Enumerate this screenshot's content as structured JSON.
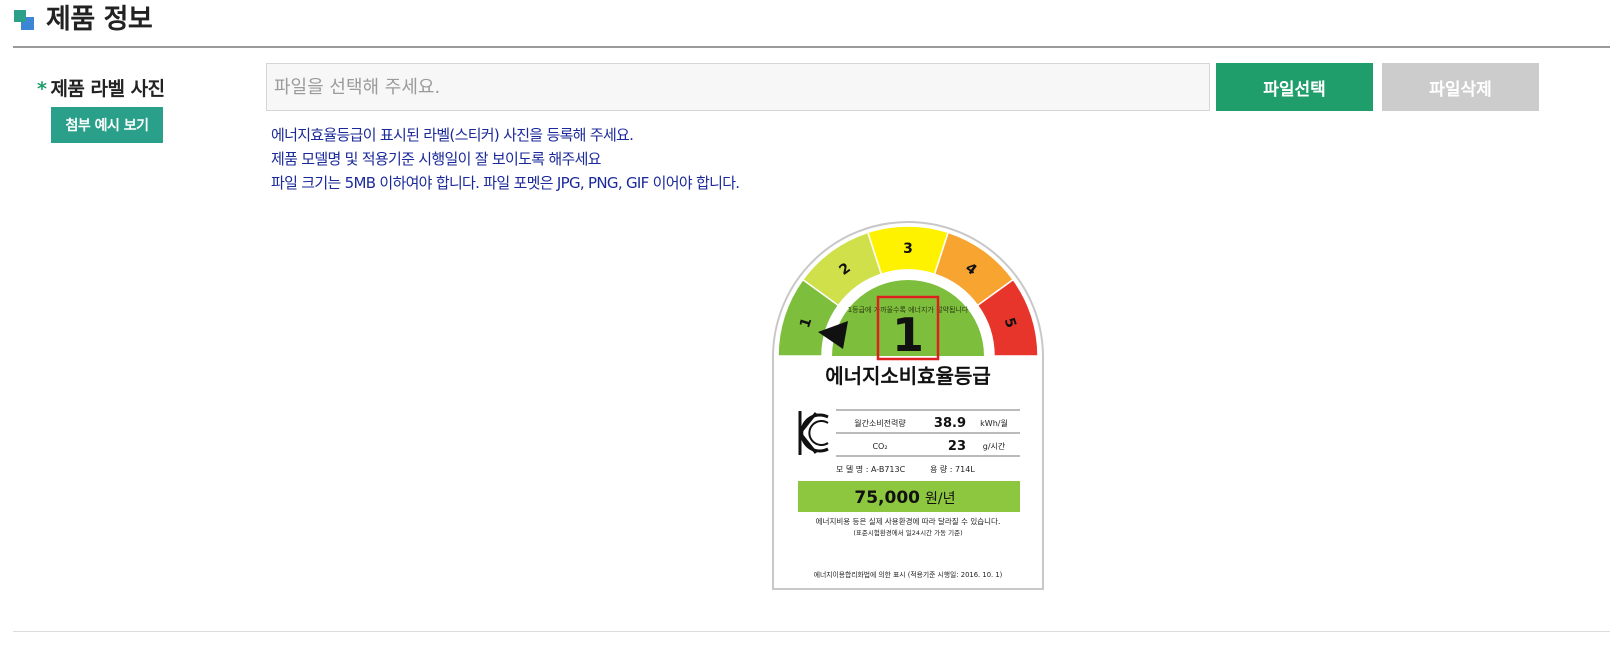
{
  "section": {
    "title": "제품 정보"
  },
  "field": {
    "required_mark": "*",
    "label": "제품 라벨 사진",
    "example_button": "첨부 예시 보기",
    "file_placeholder": "파일을 선택해 주세요.",
    "select_button": "파일선택",
    "delete_button": "파일삭제"
  },
  "notes": [
    "에너지효율등급이 표시된 라벨(스티커) 사진을 등록해 주세요.",
    "제품 모델명 및 적용기준 시행일이 잘 보이도록 해주세요",
    "파일 크기는 5MB 이하여야 합니다. 파일 포멧은 JPG, PNG, GIF 이어야 합니다."
  ],
  "energy_label": {
    "grades": [
      "1",
      "2",
      "3",
      "4",
      "5"
    ],
    "current_grade": "1",
    "arc_text": "1등급에 가까울수록 에너지가 절약됩니다",
    "title": "에너지소비효율등급",
    "rows": [
      {
        "name": "월간소비전력량",
        "value": "38.9",
        "unit": "kWh/월"
      },
      {
        "name": "CO₂",
        "value": "23",
        "unit": "g/시간"
      }
    ],
    "model_line": "모 델 명 : A-B713C",
    "capacity_line": "용    량 : 714L",
    "cost": "75,000",
    "cost_unit": "원/년",
    "note1": "에너지비용 등은 실제 사용환경에 따라 달라질 수 있습니다.",
    "note2": "(표준시험환경에서 일24시간 가동 기준)",
    "footer": "에너지이용합리화법에 의한 표시 (적용기준 시행일: 2016. 10. 1)",
    "colors": {
      "grade1": "#7dbf3c",
      "grade2": "#cfe04a",
      "grade3": "#fff200",
      "grade4": "#f7a530",
      "grade5": "#e8352b",
      "highlight_box": "#e02020",
      "cost_bar": "#8dc63f"
    }
  }
}
